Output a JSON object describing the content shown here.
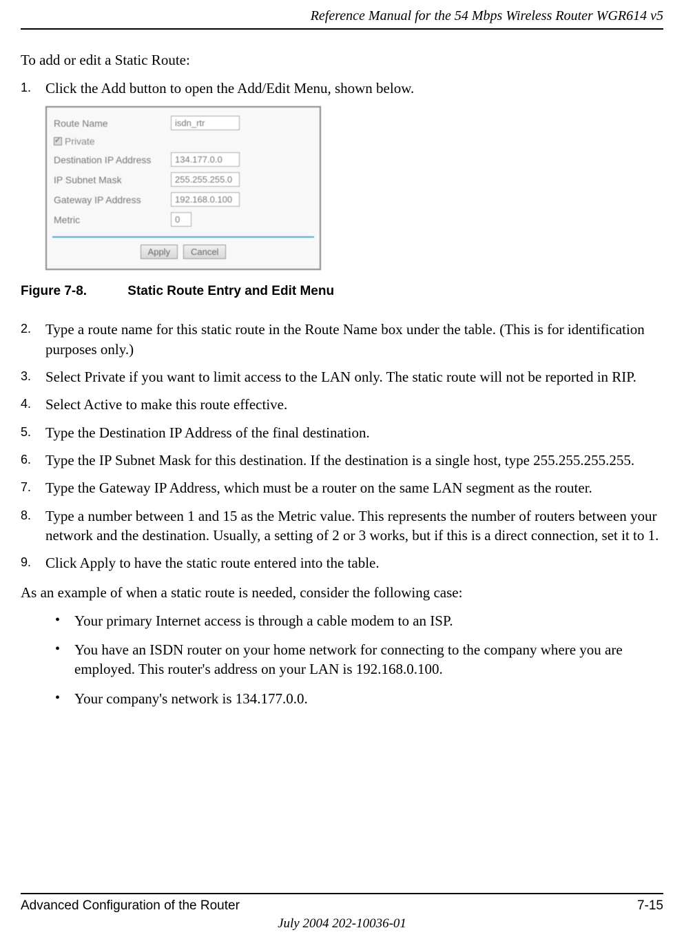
{
  "header": {
    "title": "Reference Manual for the 54 Mbps Wireless Router WGR614 v5"
  },
  "intro": "To add or edit a Static Route:",
  "steps": [
    "Click the Add button to open the Add/Edit Menu, shown below.",
    "Type a route name for this static route in the Route Name box under the table. (This is for identification purposes only.)",
    "Select Private if you want to limit access to the LAN only. The static route will not be reported in RIP.",
    "Select Active to make this route effective.",
    "Type the Destination IP Address of the final destination.",
    "Type the IP Subnet Mask for this destination. If the destination is a single host, type 255.255.255.255.",
    "Type the Gateway IP Address, which must be a router on the same LAN segment as the router.",
    "Type a number between 1 and 15 as the Metric value. This represents the number of routers between your network and the destination. Usually, a setting of 2 or 3 works, but if this is a direct connection, set it to 1.",
    "Click Apply to have the static route entered into the table."
  ],
  "figure": {
    "fields": {
      "route_name_label": "Route Name",
      "route_name_value": "isdn_rtr",
      "private_label": "Private",
      "dest_ip_label": "Destination IP Address",
      "dest_ip_value": "134.177.0.0",
      "subnet_label": "IP Subnet Mask",
      "subnet_value": "255.255.255.0",
      "gateway_label": "Gateway IP Address",
      "gateway_value": "192.168.0.100",
      "metric_label": "Metric",
      "metric_value": "0"
    },
    "buttons": {
      "apply": "Apply",
      "cancel": "Cancel"
    }
  },
  "caption": {
    "label": "Figure 7-8.",
    "text": "Static Route Entry and Edit Menu"
  },
  "example_intro": "As an example of when a static route is needed, consider the following case:",
  "bullets": [
    "Your primary Internet access is through a cable modem to an ISP.",
    "You have an ISDN router on your home network for connecting to the company where you are employed. This router's address on your LAN is 192.168.0.100.",
    "Your company's network is 134.177.0.0."
  ],
  "footer": {
    "section": "Advanced Configuration of the Router",
    "page": "7-15",
    "date": "July 2004 202-10036-01"
  }
}
